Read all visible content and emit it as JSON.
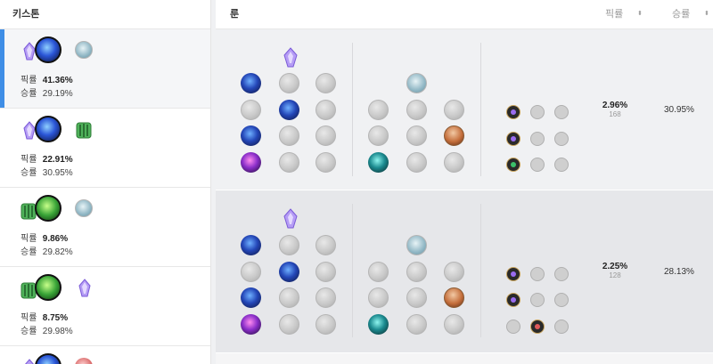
{
  "left_panel": {
    "header": "키스톤",
    "keystones": [
      {
        "pick_label": "픽률",
        "pick": "41.36%",
        "win_label": "승률",
        "win": "29.19%"
      },
      {
        "pick_label": "픽률",
        "pick": "22.91%",
        "win_label": "승률",
        "win": "30.95%"
      },
      {
        "pick_label": "픽률",
        "pick": "9.86%",
        "win_label": "승률",
        "win": "29.82%"
      },
      {
        "pick_label": "픽률",
        "pick": "8.75%",
        "win_label": "승률",
        "win": "29.98%"
      }
    ]
  },
  "right_panel": {
    "header_title": "룬",
    "col_pick": "픽률",
    "col_win": "승률",
    "sort_icon": "⬍",
    "rows": [
      {
        "pick": "2.96%",
        "count": "168",
        "win": "30.95%"
      },
      {
        "pick": "2.25%",
        "count": "128",
        "win": "28.13%"
      }
    ]
  },
  "colors": {
    "accent": "#3f8ee6",
    "row_bg": "#f0f1f3",
    "row_bg_alt": "#e6e7ea"
  }
}
